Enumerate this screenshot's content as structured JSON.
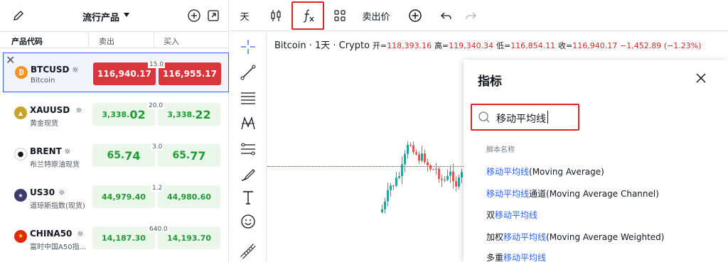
{
  "watchlist": {
    "title": "流行产品",
    "columns": {
      "symbol": "产品代码",
      "sell": "卖出",
      "buy": "买入"
    },
    "rows": [
      {
        "symbol": "BTCUSD",
        "name": "Bitcoin",
        "sell": "116,940.17",
        "buy": "116,955.17",
        "spread": "15.0",
        "style": "red",
        "icon_color": "#f7931a",
        "icon": "₿"
      },
      {
        "symbol": "XAUUSD",
        "name": "黄金现货",
        "sell_main": "3,338.",
        "sell_big": "02",
        "buy_main": "3,338.",
        "buy_big": "22",
        "spread": "20.0",
        "style": "green",
        "icon_color": "#c9a227",
        "icon": "▲"
      },
      {
        "symbol": "BRENT",
        "name": "布兰特原油现货",
        "sell_main": "65.",
        "sell_big": "74",
        "buy_main": "65.",
        "buy_big": "77",
        "spread": "3.0",
        "style": "green",
        "icon_color": "#ffffff",
        "icon": "●"
      },
      {
        "symbol": "US30",
        "name": "道琼斯指数(现货)",
        "sell_main": "44,979.",
        "sell_big": "40",
        "buy_main": "44,980.",
        "buy_big": "60",
        "spread": "1.2",
        "style": "green",
        "icon_color": "#3c3b6e",
        "icon": "★"
      },
      {
        "symbol": "CHINA50",
        "name": "富时中国A50指...",
        "sell_main": "14,187.",
        "sell_big": "30",
        "buy_main": "14,193.",
        "buy_big": "70",
        "spread": "640.0",
        "style": "green",
        "icon_color": "#de2910",
        "icon": "★"
      }
    ]
  },
  "toolbar": {
    "interval": "天",
    "bid_ask": "卖出价"
  },
  "chart": {
    "symbol": "Bitcoin · 1天 · Crypto",
    "open_label": "开=",
    "open": "118,393.16",
    "high_label": "高=",
    "high": "119,340.34",
    "low_label": "低=",
    "low": "116,854.11",
    "close_label": "收=",
    "close": "116,940.17",
    "change": "−1,452.89 (−1.23%)",
    "up_color": "#26a69a",
    "down_color": "#ef5350"
  },
  "indicators_dialog": {
    "title": "指标",
    "search_value": "移动平均线",
    "section": "脚本名称",
    "results": [
      {
        "pre": "",
        "hl": "移动平均线",
        "post": "(Moving Average)"
      },
      {
        "pre": "",
        "hl": "移动平均线",
        "post": "通道(Moving Average Channel)"
      },
      {
        "pre": "双",
        "hl": "移动平均线",
        "post": ""
      },
      {
        "pre": "加权",
        "hl": "移动平均线",
        "post": "(Moving Average Weighted)"
      },
      {
        "pre": "多重",
        "hl": "移动平均线",
        "post": ""
      }
    ]
  }
}
